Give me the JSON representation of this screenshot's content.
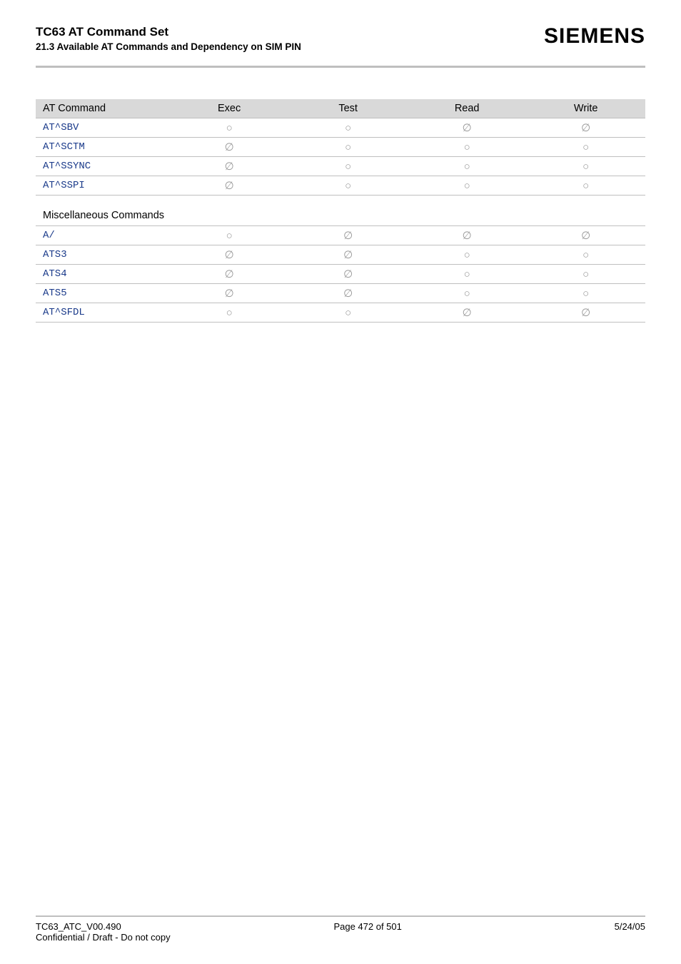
{
  "header": {
    "title": "TC63 AT Command Set",
    "subtitle": "21.3 Available AT Commands and Dependency on SIM PIN",
    "logo": "SIEMENS"
  },
  "table": {
    "headers": {
      "c0": "AT Command",
      "c1": "Exec",
      "c2": "Test",
      "c3": "Read",
      "c4": "Write"
    },
    "section_label": "Miscellaneous Commands",
    "rows_a": [
      {
        "name": "AT^SBV",
        "exec": "○",
        "test": "○",
        "read": "∅",
        "write": "∅"
      },
      {
        "name": "AT^SCTM",
        "exec": "∅",
        "test": "○",
        "read": "○",
        "write": "○"
      },
      {
        "name": "AT^SSYNC",
        "exec": "∅",
        "test": "○",
        "read": "○",
        "write": "○"
      },
      {
        "name": "AT^SSPI",
        "exec": "∅",
        "test": "○",
        "read": "○",
        "write": "○"
      }
    ],
    "rows_b": [
      {
        "name": "A/",
        "exec": "○",
        "test": "∅",
        "read": "∅",
        "write": "∅"
      },
      {
        "name": "ATS3",
        "exec": "∅",
        "test": "∅",
        "read": "○",
        "write": "○"
      },
      {
        "name": "ATS4",
        "exec": "∅",
        "test": "∅",
        "read": "○",
        "write": "○"
      },
      {
        "name": "ATS5",
        "exec": "∅",
        "test": "∅",
        "read": "○",
        "write": "○"
      },
      {
        "name": "AT^SFDL",
        "exec": "○",
        "test": "○",
        "read": "∅",
        "write": "∅"
      }
    ]
  },
  "footer": {
    "left": "TC63_ATC_V00.490",
    "center": "Page 472 of 501",
    "right": "5/24/05",
    "bottom": "Confidential / Draft - Do not copy"
  }
}
